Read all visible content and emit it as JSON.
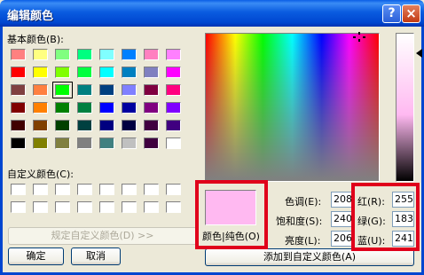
{
  "window": {
    "title": "编辑颜色",
    "help_icon": "?",
    "close_icon": "×"
  },
  "basic_colors": {
    "label": "基本颜色(B):",
    "swatches": [
      [
        "#ff8080",
        "#ffff80",
        "#80ff80",
        "#00ff80",
        "#80ffff",
        "#0080ff",
        "#ff80c0",
        "#ff80ff"
      ],
      [
        "#ff0000",
        "#ffff00",
        "#80ff00",
        "#00ff40",
        "#00ffff",
        "#0080c0",
        "#8080c0",
        "#ff00ff"
      ],
      [
        "#804040",
        "#ff8040",
        "#00ff00",
        "#008080",
        "#004080",
        "#8080ff",
        "#800040",
        "#ff0080"
      ],
      [
        "#800000",
        "#ff8000",
        "#008000",
        "#008040",
        "#0000ff",
        "#0000a0",
        "#800080",
        "#8000ff"
      ],
      [
        "#400000",
        "#804000",
        "#004000",
        "#004040",
        "#000080",
        "#000040",
        "#400040",
        "#400080"
      ],
      [
        "#000000",
        "#808000",
        "#808040",
        "#808080",
        "#408080",
        "#c0c0c0",
        "#400040",
        "#ffffff"
      ]
    ]
  },
  "custom_colors": {
    "label": "自定义颜色(C):"
  },
  "buttons": {
    "define_custom": "规定自定义颜色(D) >>",
    "ok": "确定",
    "cancel": "取消",
    "add_custom": "添加到自定义颜色(A)"
  },
  "preview": {
    "color": "#ffb9f1",
    "label": "颜色|纯色(O)"
  },
  "hsl": {
    "hue_label": "色调(E):",
    "hue": "208",
    "sat_label": "饱和度(S):",
    "sat": "240",
    "lum_label": "亮度(L):",
    "lum": "206"
  },
  "rgb": {
    "red_label": "红(R):",
    "red": "255",
    "green_label": "绿(G):",
    "green": "183",
    "blue_label": "蓝(U):",
    "blue": "241"
  },
  "highlight_color": "#e0001b"
}
